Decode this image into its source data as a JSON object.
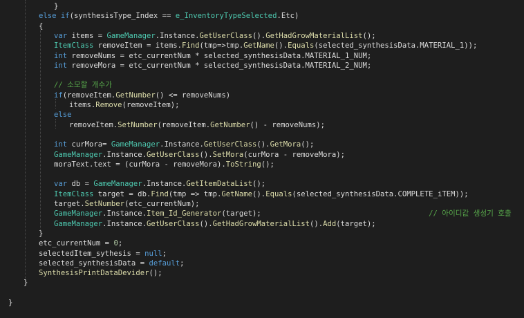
{
  "editor": {
    "background": "#1e1e1e",
    "colors": {
      "plain": "#dcdcdc",
      "keyword": "#569cd6",
      "type": "#4ec9b0",
      "method": "#dcdcaa",
      "comment": "#57a64a",
      "number": "#b5cea8"
    },
    "lines": [
      {
        "indent": 3,
        "tokens": [
          {
            "t": "}",
            "k": "plain"
          }
        ]
      },
      {
        "indent": 2,
        "tokens": [
          {
            "t": "else",
            "k": "keyword"
          },
          {
            "t": " ",
            "k": "plain"
          },
          {
            "t": "if",
            "k": "keyword"
          },
          {
            "t": "(synthesisType_Index == ",
            "k": "plain"
          },
          {
            "t": "e_InventoryTypeSelected",
            "k": "type"
          },
          {
            "t": ".Etc)",
            "k": "plain"
          }
        ]
      },
      {
        "indent": 2,
        "tokens": [
          {
            "t": "{",
            "k": "plain"
          }
        ]
      },
      {
        "indent": 3,
        "tokens": [
          {
            "t": "var",
            "k": "keyword"
          },
          {
            "t": " items = ",
            "k": "plain"
          },
          {
            "t": "GameManager",
            "k": "type"
          },
          {
            "t": ".Instance.",
            "k": "plain"
          },
          {
            "t": "GetUserClass",
            "k": "method"
          },
          {
            "t": "().",
            "k": "plain"
          },
          {
            "t": "GetHadGrowMaterialList",
            "k": "method"
          },
          {
            "t": "();",
            "k": "plain"
          }
        ]
      },
      {
        "indent": 3,
        "tokens": [
          {
            "t": "ItemClass",
            "k": "type"
          },
          {
            "t": " removeItem = items.",
            "k": "plain"
          },
          {
            "t": "Find",
            "k": "method"
          },
          {
            "t": "(tmp=>tmp.",
            "k": "plain"
          },
          {
            "t": "GetName",
            "k": "method"
          },
          {
            "t": "().",
            "k": "plain"
          },
          {
            "t": "Equals",
            "k": "method"
          },
          {
            "t": "(selected_synthesisData.MATERIAL_1));",
            "k": "plain"
          }
        ]
      },
      {
        "indent": 3,
        "tokens": [
          {
            "t": "int",
            "k": "keyword"
          },
          {
            "t": " removeNums = etc_currentNum * selected_synthesisData.MATERIAL_1_NUM;",
            "k": "plain"
          }
        ]
      },
      {
        "indent": 3,
        "tokens": [
          {
            "t": "int",
            "k": "keyword"
          },
          {
            "t": " removeMora = etc_currentNum * selected_synthesisData.MATERIAL_2_NUM;",
            "k": "plain"
          }
        ]
      },
      {
        "indent": 0,
        "tokens": []
      },
      {
        "indent": 3,
        "tokens": [
          {
            "t": "// 소모할 개수가",
            "k": "comment"
          }
        ]
      },
      {
        "indent": 3,
        "tokens": [
          {
            "t": "if",
            "k": "keyword"
          },
          {
            "t": "(removeItem.",
            "k": "plain"
          },
          {
            "t": "GetNumber",
            "k": "method"
          },
          {
            "t": "() <= removeNums)",
            "k": "plain"
          }
        ]
      },
      {
        "indent": 4,
        "tokens": [
          {
            "t": "items.",
            "k": "plain"
          },
          {
            "t": "Remove",
            "k": "method"
          },
          {
            "t": "(removeItem);",
            "k": "plain"
          }
        ]
      },
      {
        "indent": 3,
        "tokens": [
          {
            "t": "else",
            "k": "keyword"
          }
        ]
      },
      {
        "indent": 4,
        "tokens": [
          {
            "t": "removeItem.",
            "k": "plain"
          },
          {
            "t": "SetNumber",
            "k": "method"
          },
          {
            "t": "(removeItem.",
            "k": "plain"
          },
          {
            "t": "GetNumber",
            "k": "method"
          },
          {
            "t": "() - removeNums);",
            "k": "plain"
          }
        ]
      },
      {
        "indent": 0,
        "tokens": []
      },
      {
        "indent": 3,
        "tokens": [
          {
            "t": "int",
            "k": "keyword"
          },
          {
            "t": " curMora= ",
            "k": "plain"
          },
          {
            "t": "GameManager",
            "k": "type"
          },
          {
            "t": ".Instance.",
            "k": "plain"
          },
          {
            "t": "GetUserClass",
            "k": "method"
          },
          {
            "t": "().",
            "k": "plain"
          },
          {
            "t": "GetMora",
            "k": "method"
          },
          {
            "t": "();",
            "k": "plain"
          }
        ]
      },
      {
        "indent": 3,
        "tokens": [
          {
            "t": "GameManager",
            "k": "type"
          },
          {
            "t": ".Instance.",
            "k": "plain"
          },
          {
            "t": "GetUserClass",
            "k": "method"
          },
          {
            "t": "().",
            "k": "plain"
          },
          {
            "t": "SetMora",
            "k": "method"
          },
          {
            "t": "(curMora - removeMora);",
            "k": "plain"
          }
        ]
      },
      {
        "indent": 3,
        "tokens": [
          {
            "t": "moraText.text = (curMora - removeMora).",
            "k": "plain"
          },
          {
            "t": "ToString",
            "k": "method"
          },
          {
            "t": "();",
            "k": "plain"
          }
        ]
      },
      {
        "indent": 0,
        "tokens": []
      },
      {
        "indent": 3,
        "tokens": [
          {
            "t": "var",
            "k": "keyword"
          },
          {
            "t": " db = ",
            "k": "plain"
          },
          {
            "t": "GameManager",
            "k": "type"
          },
          {
            "t": ".Instance.",
            "k": "plain"
          },
          {
            "t": "GetItemDataList",
            "k": "method"
          },
          {
            "t": "();",
            "k": "plain"
          }
        ]
      },
      {
        "indent": 3,
        "tokens": [
          {
            "t": "ItemClass",
            "k": "type"
          },
          {
            "t": " target = db.",
            "k": "plain"
          },
          {
            "t": "Find",
            "k": "method"
          },
          {
            "t": "(tmp => tmp.",
            "k": "plain"
          },
          {
            "t": "GetName",
            "k": "method"
          },
          {
            "t": "().",
            "k": "plain"
          },
          {
            "t": "Equals",
            "k": "method"
          },
          {
            "t": "(selected_synthesisData.COMPLETE_iTEM));",
            "k": "plain"
          }
        ]
      },
      {
        "indent": 3,
        "tokens": [
          {
            "t": "target.",
            "k": "plain"
          },
          {
            "t": "SetNumber",
            "k": "method"
          },
          {
            "t": "(etc_currentNum);",
            "k": "plain"
          }
        ]
      },
      {
        "indent": 3,
        "tokens": [
          {
            "t": "GameManager",
            "k": "type"
          },
          {
            "t": ".Instance.",
            "k": "plain"
          },
          {
            "t": "Item_Id_Generator",
            "k": "method"
          },
          {
            "t": "(target);                                      ",
            "k": "plain"
          },
          {
            "t": "// 아이디값 생성기 호출",
            "k": "comment"
          }
        ]
      },
      {
        "indent": 3,
        "tokens": [
          {
            "t": "GameManager",
            "k": "type"
          },
          {
            "t": ".Instance.",
            "k": "plain"
          },
          {
            "t": "GetUserClass",
            "k": "method"
          },
          {
            "t": "().",
            "k": "plain"
          },
          {
            "t": "GetHadGrowMaterialList",
            "k": "method"
          },
          {
            "t": "().",
            "k": "plain"
          },
          {
            "t": "Add",
            "k": "method"
          },
          {
            "t": "(target);",
            "k": "plain"
          }
        ]
      },
      {
        "indent": 2,
        "tokens": [
          {
            "t": "}",
            "k": "plain"
          }
        ]
      },
      {
        "indent": 2,
        "tokens": [
          {
            "t": "etc_currentNum = ",
            "k": "plain"
          },
          {
            "t": "0",
            "k": "number"
          },
          {
            "t": ";",
            "k": "plain"
          }
        ]
      },
      {
        "indent": 2,
        "tokens": [
          {
            "t": "selectedItem_sythesis = ",
            "k": "plain"
          },
          {
            "t": "null",
            "k": "keyword"
          },
          {
            "t": ";",
            "k": "plain"
          }
        ]
      },
      {
        "indent": 2,
        "tokens": [
          {
            "t": "selected_synthesisData = ",
            "k": "plain"
          },
          {
            "t": "default",
            "k": "keyword"
          },
          {
            "t": ";",
            "k": "plain"
          }
        ]
      },
      {
        "indent": 2,
        "tokens": [
          {
            "t": "SynthesisPrintDataDevider",
            "k": "method"
          },
          {
            "t": "();",
            "k": "plain"
          }
        ]
      },
      {
        "indent": 1,
        "tokens": [
          {
            "t": "}",
            "k": "plain"
          }
        ]
      },
      {
        "indent": 0,
        "tokens": []
      },
      {
        "indent": 0,
        "tokens": [
          {
            "t": "}",
            "k": "plain"
          }
        ]
      }
    ]
  }
}
